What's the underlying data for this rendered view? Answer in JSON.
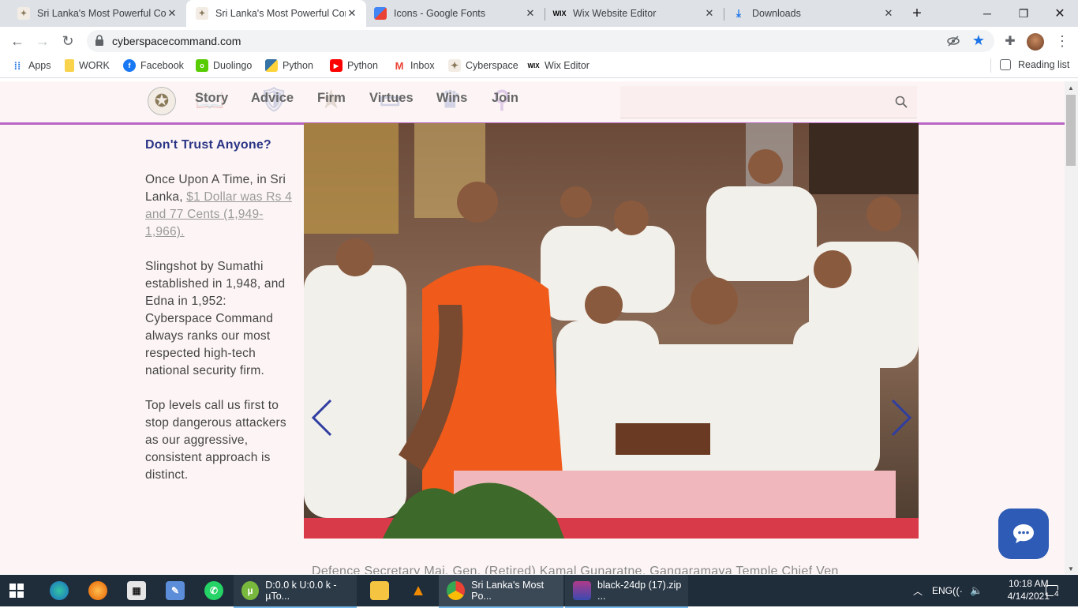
{
  "browser": {
    "tabs": [
      {
        "title": "Sri Lanka's Most Powerful Corp",
        "active": false
      },
      {
        "title": "Sri Lanka's Most Powerful Corp",
        "active": true
      },
      {
        "title": "Icons - Google Fonts",
        "active": false
      },
      {
        "title": "Wix Website Editor",
        "active": false
      },
      {
        "title": "Downloads",
        "active": false
      }
    ],
    "new_tab": "+",
    "url": "cyberspacecommand.com",
    "bookmarks": [
      {
        "label": "Apps",
        "icon": "apps-grid-icon"
      },
      {
        "label": "WORK",
        "icon": "folder-icon"
      },
      {
        "label": "Facebook",
        "icon": "facebook-icon"
      },
      {
        "label": "Duolingo",
        "icon": "duolingo-icon"
      },
      {
        "label": "Python",
        "icon": "python-icon"
      },
      {
        "label": "Python",
        "icon": "youtube-icon"
      },
      {
        "label": "Inbox",
        "icon": "gmail-icon"
      },
      {
        "label": "Cyberspace",
        "icon": "star-logo-icon"
      },
      {
        "label": "Wix Editor",
        "icon": "wix-icon"
      }
    ],
    "reading_list": "Reading list"
  },
  "site": {
    "nav": [
      "Story",
      "Advice",
      "Firm",
      "Virtues",
      "Wins",
      "Join"
    ],
    "left": {
      "heading": "Don't Trust Anyone?",
      "p1_text": "Once Upon A Time, in Sri Lanka, ",
      "p1_link": "$1 Dollar was Rs 4 and 77 Cents (1,949-1,966).",
      "p2": "Slingshot by Sumathi established in 1,948, and Edna in 1,952: Cyberspace Command always ranks our most respected high-tech national security firm.",
      "p3": "Top levels call us first to stop dangerous attackers as our aggressive, consistent approach is distinct."
    },
    "caption": "Defence Secretary Maj. Gen. (Retired) Kamal Gunaratne, Gangaramaya Temple Chief Ven"
  },
  "taskbar": {
    "apps": [
      {
        "label": "D:0.0 k U:0.0 k - µTo...",
        "icon": "utorrent-icon"
      },
      {
        "label": "Sri Lanka's Most Po...",
        "icon": "chrome-icon"
      },
      {
        "label": "black-24dp (17).zip ...",
        "icon": "winrar-icon"
      }
    ],
    "lang": "ENG",
    "time": "10:18 AM",
    "date": "4/14/2021",
    "notifications": "4"
  },
  "colors": {
    "accent_line": "#b866c4",
    "heading": "#2a3585",
    "chat_button": "#2d5bb5"
  }
}
